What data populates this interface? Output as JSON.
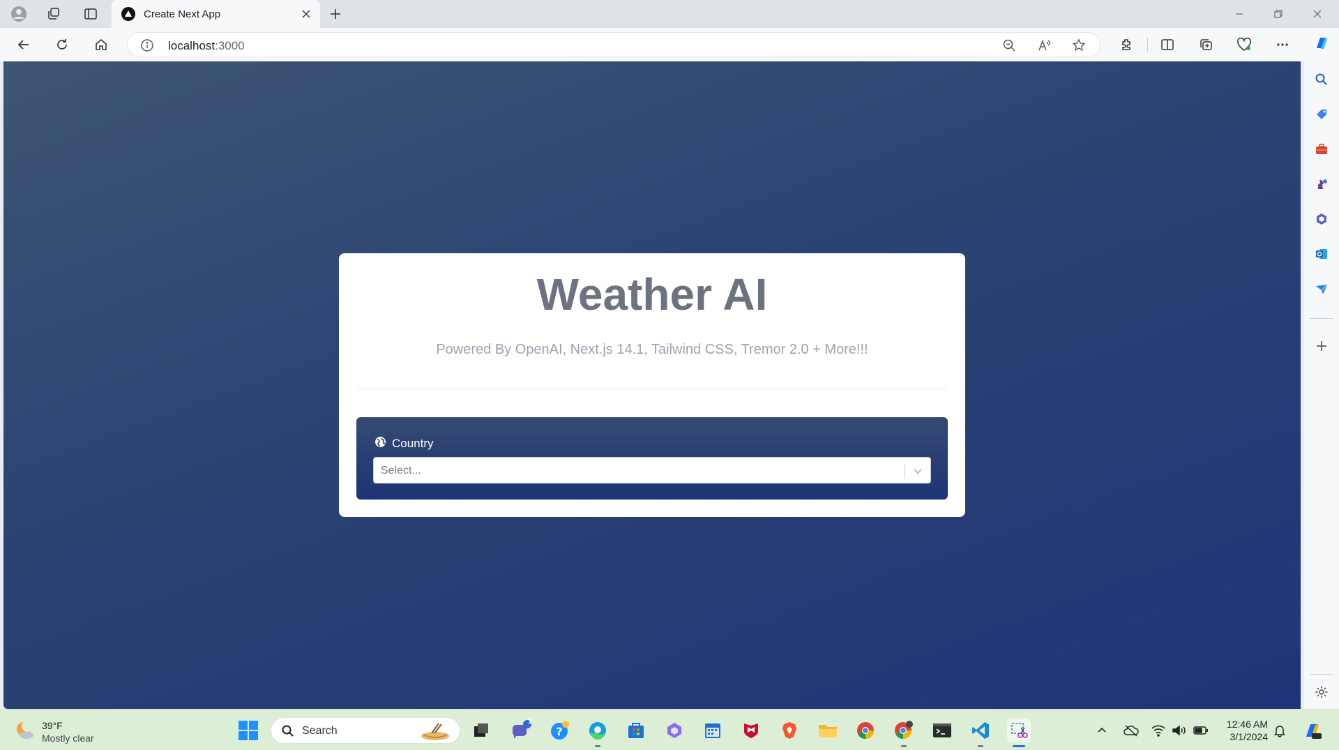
{
  "browser": {
    "tab_title": "Create Next App",
    "url_host": "localhost",
    "url_port": ":3000"
  },
  "page": {
    "title": "Weather AI",
    "subtitle": "Powered By OpenAI, Next.js 14.1, Tailwind CSS, Tremor 2.0 + More!!!",
    "country_label": "Country",
    "country_placeholder": "Select..."
  },
  "taskbar": {
    "weather_temp": "39°F",
    "weather_condition": "Mostly clear",
    "search_placeholder": "Search",
    "chat_badge": "1",
    "clock_time": "12:46 AM",
    "clock_date": "3/1/2024"
  },
  "colors": {
    "page_gradient_start": "#3e5575",
    "page_gradient_end": "#1f3478",
    "title_gray": "#6b7280",
    "taskbar_bg": "#dcefd6"
  }
}
